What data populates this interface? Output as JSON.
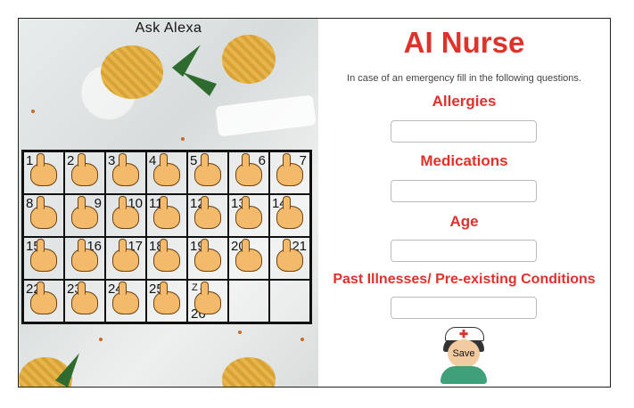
{
  "camera": {
    "label": "Ask Alexa",
    "cells": [
      {
        "num": "1",
        "pos": "tl"
      },
      {
        "num": "2",
        "pos": "tl"
      },
      {
        "num": "3",
        "pos": "tl"
      },
      {
        "num": "4",
        "pos": "tl"
      },
      {
        "num": "5",
        "pos": "tl"
      },
      {
        "num": "6",
        "pos": "tr"
      },
      {
        "num": "7",
        "pos": "tr"
      },
      {
        "num": "8",
        "pos": "tl"
      },
      {
        "num": "9",
        "pos": "tr"
      },
      {
        "num": "10",
        "pos": "tr"
      },
      {
        "num": "11",
        "pos": "tl"
      },
      {
        "num": "12",
        "pos": "tl"
      },
      {
        "num": "13",
        "pos": "tl"
      },
      {
        "num": "14",
        "pos": "tl"
      },
      {
        "num": "15",
        "pos": "tl"
      },
      {
        "num": "16",
        "pos": "tr"
      },
      {
        "num": "17",
        "pos": "tr"
      },
      {
        "num": "18",
        "pos": "tl"
      },
      {
        "num": "19",
        "pos": "tl"
      },
      {
        "num": "20",
        "pos": "tl"
      },
      {
        "num": "21",
        "pos": "tr"
      },
      {
        "num": "22",
        "pos": "tl"
      },
      {
        "num": "23",
        "pos": "tl"
      },
      {
        "num": "24",
        "pos": "tl"
      },
      {
        "num": "25",
        "pos": "tl"
      },
      {
        "num": "26",
        "pos": "bl",
        "arrow": "Z→"
      },
      {
        "num": "",
        "pos": "none"
      },
      {
        "num": "",
        "pos": "none"
      }
    ]
  },
  "form": {
    "title": "AI Nurse",
    "intro": "In case of an emergency fill in the following questions.",
    "fields": [
      {
        "label": "Allergies",
        "value": "",
        "placeholder": ""
      },
      {
        "label": "Medications",
        "value": "",
        "placeholder": ""
      },
      {
        "label": "Age",
        "value": "",
        "placeholder": ""
      },
      {
        "label": "Past Illnesses/ Pre-existing Conditions",
        "value": "",
        "placeholder": ""
      }
    ],
    "save_label": "Save"
  },
  "colors": {
    "accent": "#e0312b",
    "nurse_uniform": "#3fa07a"
  },
  "icons": {
    "save": "nurse-avatar-icon"
  }
}
